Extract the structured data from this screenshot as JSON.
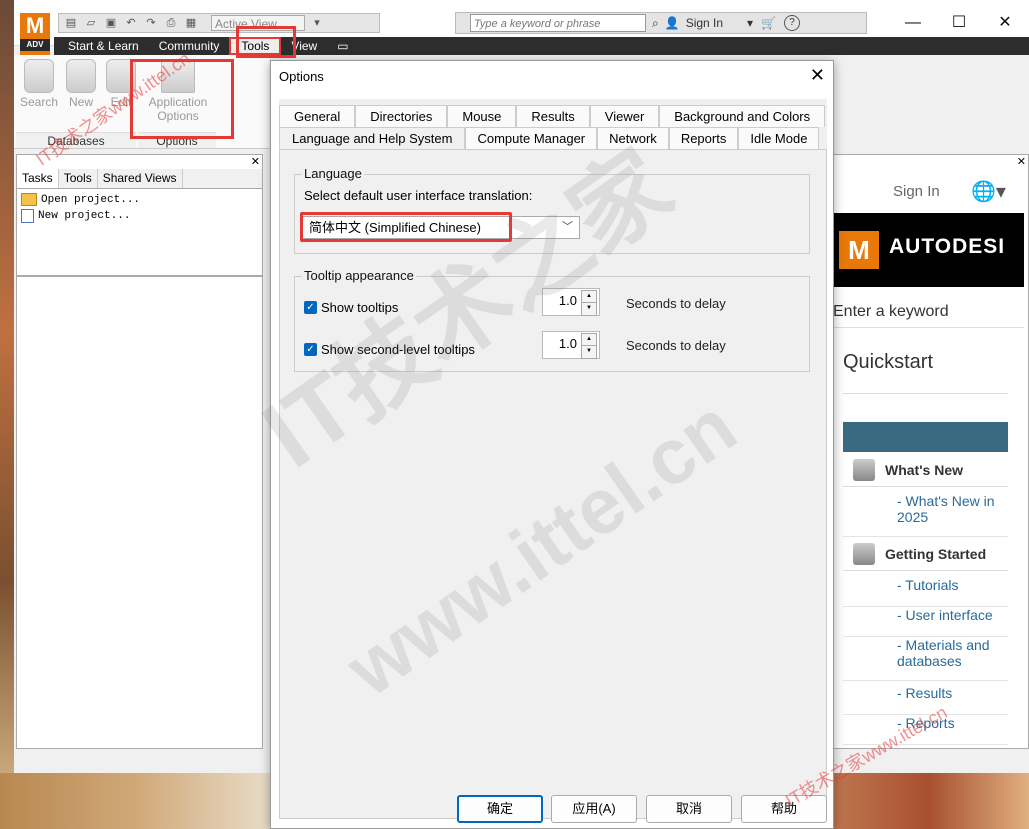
{
  "app": {
    "logo_letter": "M",
    "logo_sub": "ADV",
    "active_view": "Active View",
    "search_placeholder": "Type a keyword or phrase",
    "sign_in": "Sign In",
    "help_icon": "?",
    "window_controls": {
      "minimize": "—",
      "maximize": "☐",
      "close": "✕"
    }
  },
  "ribbon": {
    "tabs": [
      "Start & Learn",
      "Community",
      "Tools",
      "View"
    ],
    "selected_tab": "Tools",
    "buttons": [
      {
        "label": "Search"
      },
      {
        "label": "New"
      },
      {
        "label": "Edit"
      }
    ],
    "app_options_line1": "Application",
    "app_options_line2": "Options",
    "groups": [
      "Databases",
      "Options"
    ]
  },
  "tasks_pane": {
    "tabs": [
      "Tasks",
      "Tools",
      "Shared Views"
    ],
    "items": [
      "Open project...",
      "New project..."
    ]
  },
  "help_page": {
    "sign_in": "Sign In",
    "logo_letter": "M",
    "brand": "AUTODESI",
    "search_placeholder": "Enter a keyword",
    "quickstart": "Quickstart",
    "sections": [
      {
        "title": "What's New",
        "links": [
          "- What's New in 2025"
        ]
      },
      {
        "title": "Getting Started",
        "links": [
          "- Tutorials",
          "- User interface",
          "- Materials and databases",
          "- Results",
          "- Reports"
        ]
      }
    ]
  },
  "dialog": {
    "title": "Options",
    "tabs_row1": [
      "General",
      "Directories",
      "Mouse",
      "Results",
      "Viewer",
      "Background and Colors"
    ],
    "tabs_row2": [
      "Language and Help System",
      "Compute Manager",
      "Network",
      "Reports",
      "Idle Mode"
    ],
    "selected_tab": "Language and Help System",
    "language_group": "Language",
    "language_prompt": "Select default user interface translation:",
    "language_value": "简体中文 (Simplified Chinese)",
    "tooltip_group": "Tooltip appearance",
    "show_tooltips": "Show tooltips",
    "show_tooltips_checked": true,
    "show_tooltips_delay": "1.0",
    "show_second_level": "Show second-level tooltips",
    "show_second_level_checked": true,
    "second_level_delay": "1.0",
    "delay_label": "Seconds to delay",
    "buttons": {
      "ok": "确定",
      "apply": "应用(A)",
      "cancel": "取消",
      "help": "帮助"
    }
  },
  "watermark": {
    "big_line1": "IT技术之家",
    "big_line2": "www.ittel.cn",
    "small1": "IT技术之家www.ittel.cn",
    "small2": "IT技术之家www.ittel.cn"
  }
}
